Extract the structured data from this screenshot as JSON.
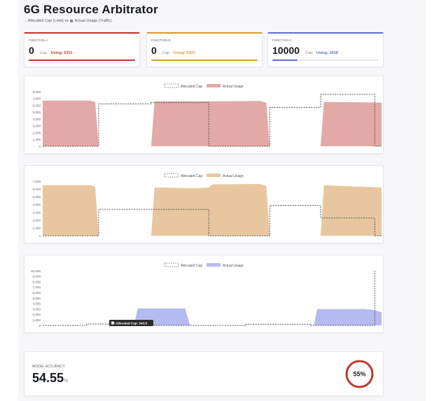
{
  "header": {
    "title": "6G Resource Arbitrator",
    "subtitle_prefix": "... Allocated Cap (Limit) vs",
    "subtitle_suffix": "Actual Usage (Traffic)."
  },
  "functions": [
    {
      "label": "FUNCTION A",
      "value": "0",
      "cap_label": "Cap",
      "using_text": "Using: 6331",
      "color": "#c0392b",
      "usage_fraction": 1.0
    },
    {
      "label": "FUNCTION B",
      "value": "0",
      "cap_label": "Cap",
      "using_text": "Using: 6331",
      "color": "#d99a2b",
      "usage_fraction": 1.0
    },
    {
      "label": "FUNCTION C",
      "value": "10000",
      "cap_label": "Cap",
      "using_text": "Using: 2418",
      "color": "#5b6fd8",
      "usage_fraction": 0.24
    }
  ],
  "chart_data": [
    {
      "type": "area",
      "legend": [
        "Allocated Cap",
        "Actual Usage"
      ],
      "legend_position": "top-center",
      "usage_color": "#e3a9a6",
      "ylim": [
        0,
        8000
      ],
      "yticks": [
        0,
        1000,
        2000,
        3000,
        4000,
        5000,
        6000,
        7000,
        8000
      ],
      "usage": [
        [
          0,
          6700
        ],
        [
          0.28,
          6700
        ],
        [
          0.31,
          6500
        ],
        [
          0.33,
          0
        ],
        [
          0.64,
          0
        ],
        [
          0.66,
          6600
        ],
        [
          0.98,
          6600
        ],
        [
          1.0,
          6600
        ],
        [
          1.02,
          6600
        ],
        [
          1.28,
          6650
        ],
        [
          1.32,
          6400
        ],
        [
          1.34,
          0
        ],
        [
          1.64,
          0
        ],
        [
          1.66,
          6500
        ],
        [
          2.0,
          6400
        ]
      ],
      "cap": [
        [
          0,
          0
        ],
        [
          0.33,
          0
        ],
        [
          0.33,
          6200
        ],
        [
          0.64,
          6200
        ],
        [
          0.64,
          6400
        ],
        [
          0.98,
          6400
        ],
        [
          0.98,
          0
        ],
        [
          1.34,
          0
        ],
        [
          1.34,
          5700
        ],
        [
          1.64,
          5700
        ],
        [
          1.64,
          7600
        ],
        [
          1.96,
          7600
        ],
        [
          1.96,
          0
        ],
        [
          2.0,
          0
        ]
      ]
    },
    {
      "type": "area",
      "legend": [
        "Allocated Cap",
        "Actual Usage"
      ],
      "legend_position": "top-center",
      "usage_color": "#e8c7a0",
      "ylim": [
        0,
        7000
      ],
      "yticks": [
        0,
        1000,
        2000,
        3000,
        4000,
        5000,
        6000,
        7000
      ],
      "usage": [
        [
          0,
          6500
        ],
        [
          0.28,
          6500
        ],
        [
          0.31,
          6300
        ],
        [
          0.33,
          0
        ],
        [
          0.64,
          0
        ],
        [
          0.66,
          6200
        ],
        [
          0.9,
          6100
        ],
        [
          0.98,
          6200
        ],
        [
          1.0,
          6600
        ],
        [
          1.28,
          6650
        ],
        [
          1.32,
          6400
        ],
        [
          1.34,
          0
        ],
        [
          1.64,
          0
        ],
        [
          1.66,
          6500
        ],
        [
          2.0,
          6200
        ]
      ],
      "cap": [
        [
          0,
          0
        ],
        [
          0.33,
          0
        ],
        [
          0.33,
          3400
        ],
        [
          0.98,
          3400
        ],
        [
          0.98,
          0
        ],
        [
          1.34,
          0
        ],
        [
          1.34,
          3900
        ],
        [
          1.64,
          3900
        ],
        [
          1.64,
          2300
        ],
        [
          1.96,
          2300
        ],
        [
          1.96,
          0
        ],
        [
          2.0,
          0
        ]
      ]
    },
    {
      "type": "area",
      "legend": [
        "Allocated Cap",
        "Actual Usage"
      ],
      "legend_position": "top-center",
      "usage_color": "#b4bbf0",
      "ylim": [
        0,
        10000
      ],
      "yticks": [
        0,
        1000,
        2000,
        3000,
        4000,
        5000,
        6000,
        7000,
        8000,
        9000,
        10000
      ],
      "tooltip": "Allocated Cap: 343.8",
      "usage": [
        [
          0,
          0
        ],
        [
          0.54,
          0
        ],
        [
          0.56,
          3100
        ],
        [
          0.84,
          3100
        ],
        [
          0.87,
          0
        ],
        [
          1.6,
          0
        ],
        [
          1.62,
          3000
        ],
        [
          1.9,
          3000
        ],
        [
          1.96,
          2800
        ],
        [
          2.0,
          2400
        ]
      ],
      "cap": [
        [
          0,
          0
        ],
        [
          0.26,
          0
        ],
        [
          0.26,
          250
        ],
        [
          0.39,
          250
        ],
        [
          0.39,
          400
        ],
        [
          0.52,
          400
        ],
        [
          0.52,
          0
        ],
        [
          1.2,
          0
        ],
        [
          1.2,
          200
        ],
        [
          1.58,
          200
        ],
        [
          1.58,
          0
        ],
        [
          1.96,
          0
        ],
        [
          1.96,
          10000
        ]
      ]
    }
  ],
  "accuracy": {
    "label": "MODEL ACCURACY",
    "value": "54.55",
    "unit": "%",
    "gauge_text": "55%",
    "gauge_color": "#c0392b"
  }
}
